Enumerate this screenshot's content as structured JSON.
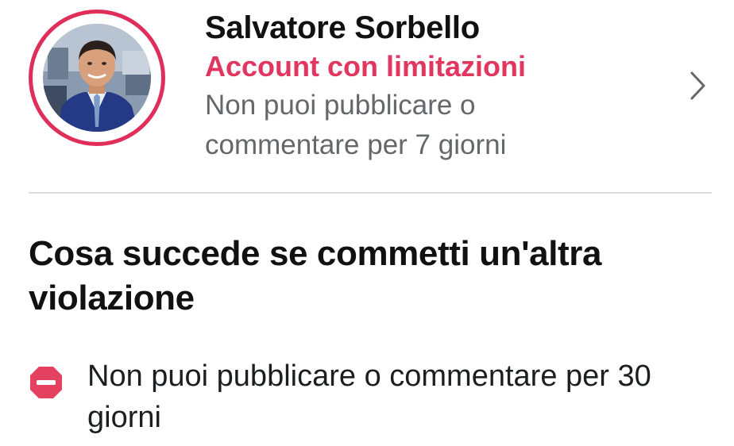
{
  "account": {
    "name": "Salvatore Sorbello",
    "status": "Account con limitazioni",
    "description": "Non puoi pubblicare o commentare per 7 giorni",
    "status_color": "#e0365f",
    "ring_color": "#e02e5a",
    "avatar_icon": "profile-photo",
    "chevron_icon": "chevron-right-icon"
  },
  "next_violation": {
    "heading": "Cosa succede se commetti un'altra violazione",
    "items": [
      {
        "icon": "stop-icon",
        "icon_color": "#e4405f",
        "text": "Non puoi pubblicare o commentare per 30 giorni"
      }
    ]
  }
}
